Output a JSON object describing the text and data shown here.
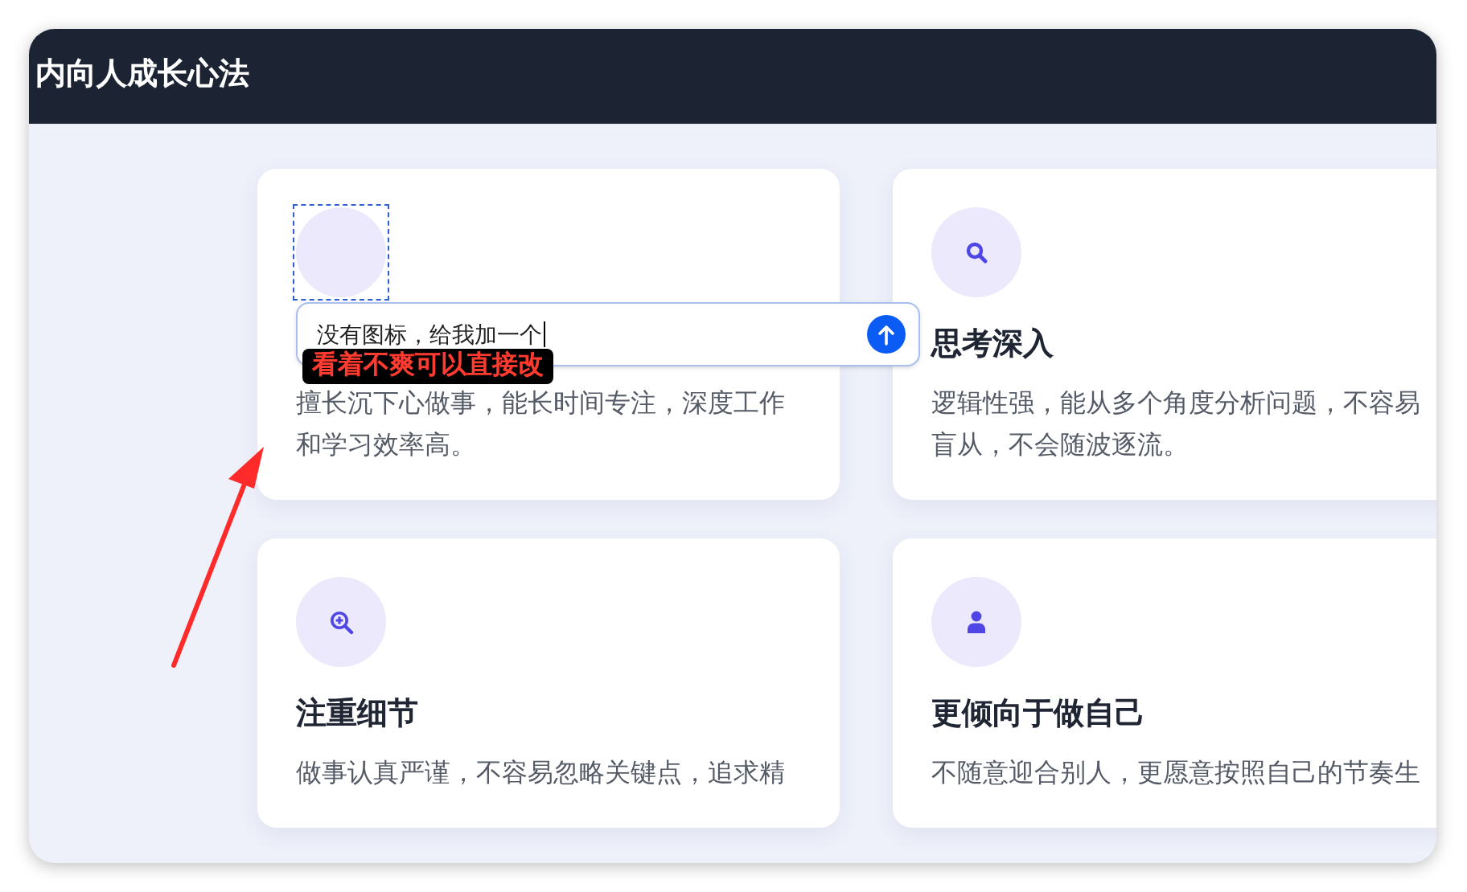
{
  "header": {
    "title": "内向人成长心法"
  },
  "cards": [
    {
      "selected": true,
      "prompt": {
        "value": "没有图标，给我加一个"
      },
      "annotation": {
        "text": "看着不爽可以直接改"
      },
      "description": "擅长沉下心做事，能长时间专注，深度工作和学习效率高。"
    },
    {
      "selected": false,
      "title": "思考深入",
      "description": "逻辑性强，能从多个角度分析问题，不容易盲从，不会随波逐流。"
    },
    {
      "selected": false,
      "title": "注重细节",
      "description": "做事认真严谨，不容易忽略关键点，追求精"
    },
    {
      "selected": false,
      "title": "更倾向于做自己",
      "description": "不随意迎合别人，更愿意按照自己的节奏生"
    }
  ]
}
